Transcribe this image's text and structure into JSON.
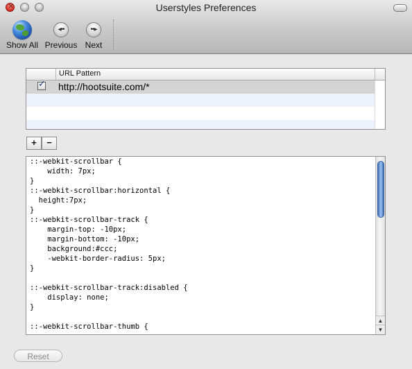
{
  "window": {
    "title": "Userstyles Preferences"
  },
  "toolbar": {
    "show_all_label": "Show All",
    "previous_label": "Previous",
    "next_label": "Next",
    "show_all_icon": "globe-icon",
    "previous_icon": "previous-icon",
    "next_icon": "next-icon"
  },
  "table": {
    "columns": [
      "",
      "URL Pattern"
    ],
    "rows": [
      {
        "enabled": true,
        "url": "http://hootsuite.com/*"
      }
    ]
  },
  "buttons": {
    "add": "+",
    "remove": "−",
    "reset": "Reset"
  },
  "editor": {
    "content": "::-webkit-scrollbar {\n    width: 7px;\n}\n::-webkit-scrollbar:horizontal {\n  height:7px;\n}\n::-webkit-scrollbar-track {\n    margin-top: -10px;\n    margin-bottom: -10px;\n    background:#ccc;\n    -webkit-border-radius: 5px;\n}\n\n::-webkit-scrollbar-track:disabled {\n    display: none;\n}\n\n::-webkit-scrollbar-thumb {"
  },
  "colors": {
    "selected_row": "#d4d4d4",
    "alt_row": "#edf3fe",
    "scroll_thumb": "#6f9de0"
  }
}
